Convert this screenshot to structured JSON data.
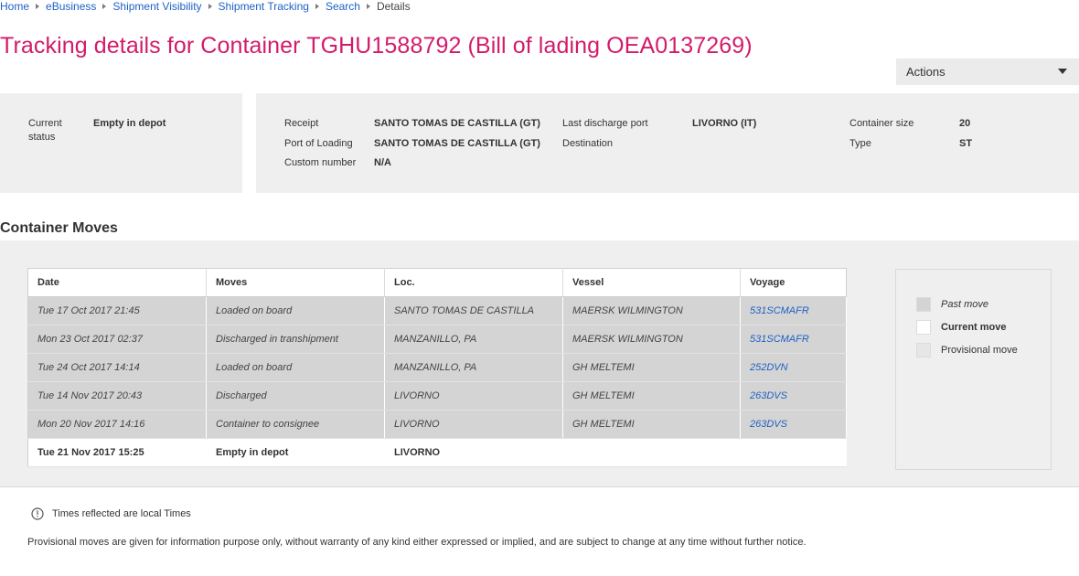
{
  "breadcrumb": {
    "items": [
      "Home",
      "eBusiness",
      "Shipment Visibility",
      "Shipment Tracking",
      "Search"
    ],
    "current": "Details"
  },
  "title": "Tracking details for Container TGHU1588792 (Bill of lading OEA0137269)",
  "actions_label": "Actions",
  "status": {
    "label_line1": "Current",
    "label_line2": "status",
    "value": "Empty in depot"
  },
  "info": {
    "receipt_label": "Receipt",
    "receipt_value": "SANTO TOMAS DE CASTILLA (GT)",
    "pol_label": "Port of Loading",
    "pol_value": "SANTO TOMAS DE CASTILLA (GT)",
    "custom_label": "Custom number",
    "custom_value": "N/A",
    "last_discharge_label": "Last discharge port",
    "last_discharge_value": "LIVORNO (IT)",
    "destination_label": "Destination",
    "destination_value": "",
    "size_label": "Container size",
    "size_value": "20",
    "type_label": "Type",
    "type_value": "ST"
  },
  "moves": {
    "section_title": "Container Moves",
    "headers": [
      "Date",
      "Moves",
      "Loc.",
      "Vessel",
      "Voyage"
    ],
    "rows": [
      {
        "date": "Tue 17 Oct 2017 21:45",
        "move": "Loaded on board",
        "loc": "SANTO TOMAS DE CASTILLA",
        "vessel": "MAERSK WILMINGTON",
        "voyage": "531SCMAFR"
      },
      {
        "date": "Mon 23 Oct 2017 02:37",
        "move": "Discharged in transhipment",
        "loc": "MANZANILLO, PA",
        "vessel": "MAERSK WILMINGTON",
        "voyage": "531SCMAFR"
      },
      {
        "date": "Tue 24 Oct 2017 14:14",
        "move": "Loaded on board",
        "loc": "MANZANILLO, PA",
        "vessel": "GH MELTEMI",
        "voyage": "252DVN"
      },
      {
        "date": "Tue 14 Nov 2017 20:43",
        "move": "Discharged",
        "loc": "LIVORNO",
        "vessel": "GH MELTEMI",
        "voyage": "263DVS"
      },
      {
        "date": "Mon 20 Nov 2017 14:16",
        "move": "Container to consignee",
        "loc": "LIVORNO",
        "vessel": "GH MELTEMI",
        "voyage": "263DVS"
      },
      {
        "date": "Tue 21 Nov 2017 15:25",
        "move": "Empty in depot",
        "loc": "LIVORNO",
        "vessel": "",
        "voyage": ""
      }
    ]
  },
  "legend": {
    "past": "Past move",
    "current": "Current move",
    "provisional": "Provisional move"
  },
  "notes": {
    "times": "Times reflected are local Times",
    "disclaimer": "Provisional moves are given for information purpose only, without warranty of any kind either expressed or implied, and are subject to change at any time without further notice."
  },
  "colors": {
    "title": "#d31b6b",
    "link": "#1e61c4",
    "panel_bg": "#efefef",
    "past_row": "#d4d4d4"
  }
}
